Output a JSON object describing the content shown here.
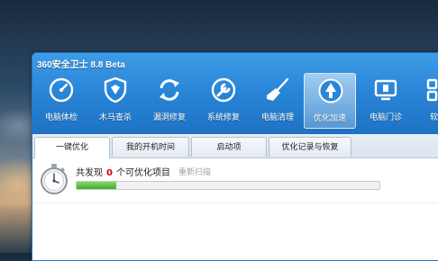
{
  "window": {
    "title": "360安全卫士 8.8 Beta"
  },
  "toolbar": {
    "items": [
      {
        "label": "电脑体检",
        "icon": "gauge-icon"
      },
      {
        "label": "木马查杀",
        "icon": "shield-icon"
      },
      {
        "label": "漏洞修复",
        "icon": "refresh-icon"
      },
      {
        "label": "系统修复",
        "icon": "wrench-icon"
      },
      {
        "label": "电脑清理",
        "icon": "broom-icon"
      },
      {
        "label": "优化加速",
        "icon": "rocket-icon",
        "active": true
      },
      {
        "label": "电脑门诊",
        "icon": "clinic-icon"
      },
      {
        "label": "软件",
        "icon": "grid-icon"
      }
    ]
  },
  "tabs": [
    {
      "label": "一键优化",
      "active": true
    },
    {
      "label": "我的开机时间"
    },
    {
      "label": "启动项"
    },
    {
      "label": "优化记录与恢复"
    }
  ],
  "scan": {
    "prefix": "共发现",
    "count": "0",
    "suffix": "个可优化项目",
    "rescan": "重新扫描",
    "progress": 0.13
  },
  "colors": {
    "header": "#2a86d8",
    "count": "#d40000",
    "progress": "#3fae2a"
  }
}
